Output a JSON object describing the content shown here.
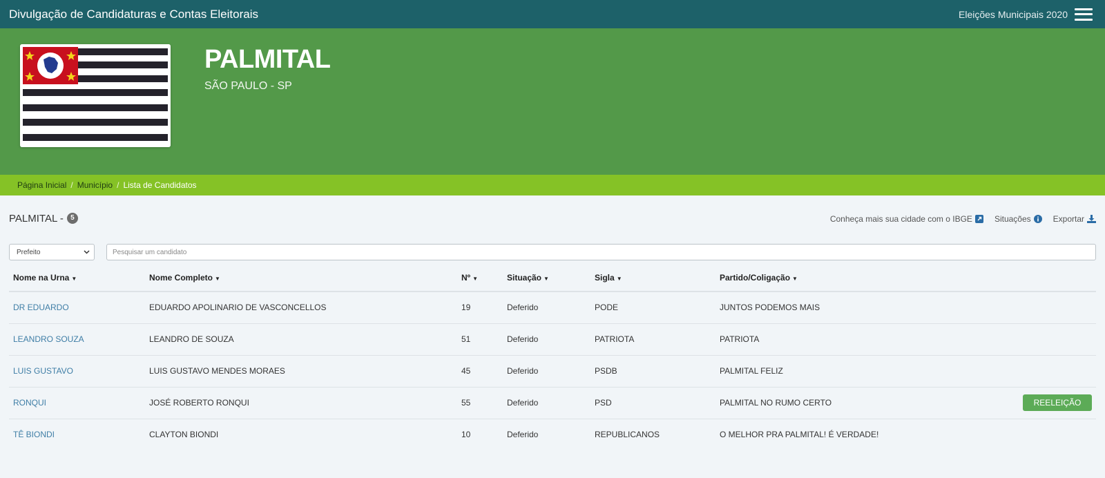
{
  "topbar": {
    "brand": "Divulgação de Candidaturas e Contas Eleitorais",
    "election": "Eleições Municipais 2020",
    "menu_icon": "hamburger-menu-icon"
  },
  "hero": {
    "city": "PALMITAL",
    "state": "SÃO PAULO - SP",
    "flag_icon": "sao-paulo-state-flag"
  },
  "breadcrumb": {
    "items": [
      "Página Inicial",
      "Município",
      "Lista de Candidatos"
    ]
  },
  "list": {
    "title": "PALMITAL -",
    "count": "5",
    "actions": {
      "ibge": "Conheça mais sua cidade com o IBGE",
      "situacoes": "Situações",
      "exportar": "Exportar"
    }
  },
  "filters": {
    "cargo_selected": "Prefeito",
    "search_placeholder": "Pesquisar um candidato"
  },
  "table": {
    "headers": [
      "Nome na Urna",
      "Nome Completo",
      "Nº",
      "Situação",
      "Sigla",
      "Partido/Coligação"
    ],
    "rows": [
      {
        "urna": "DR EDUARDO",
        "completo": "EDUARDO APOLINARIO DE VASCONCELLOS",
        "numero": "19",
        "situacao": "Deferido",
        "sigla": "PODE",
        "partido": "JUNTOS PODEMOS MAIS",
        "badge": ""
      },
      {
        "urna": "LEANDRO SOUZA",
        "completo": "LEANDRO DE SOUZA",
        "numero": "51",
        "situacao": "Deferido",
        "sigla": "PATRIOTA",
        "partido": "PATRIOTA",
        "badge": ""
      },
      {
        "urna": "LUIS GUSTAVO",
        "completo": "LUIS GUSTAVO MENDES MORAES",
        "numero": "45",
        "situacao": "Deferido",
        "sigla": "PSDB",
        "partido": "PALMITAL FELIZ",
        "badge": ""
      },
      {
        "urna": "RONQUI",
        "completo": "JOSÉ ROBERTO RONQUI",
        "numero": "55",
        "situacao": "Deferido",
        "sigla": "PSD",
        "partido": "PALMITAL NO RUMO CERTO",
        "badge": "REELEIÇÃO"
      },
      {
        "urna": "TÊ BIONDI",
        "completo": "CLAYTON BIONDI",
        "numero": "10",
        "situacao": "Deferido",
        "sigla": "REPUBLICANOS",
        "partido": "O MELHOR PRA PALMITAL! É VERDADE!",
        "badge": ""
      }
    ]
  },
  "colors": {
    "topbar": "#1d6169",
    "hero": "#539949",
    "breadcrumb": "#85c226",
    "badge_green": "#5cab57",
    "link": "#3f7ea6"
  }
}
